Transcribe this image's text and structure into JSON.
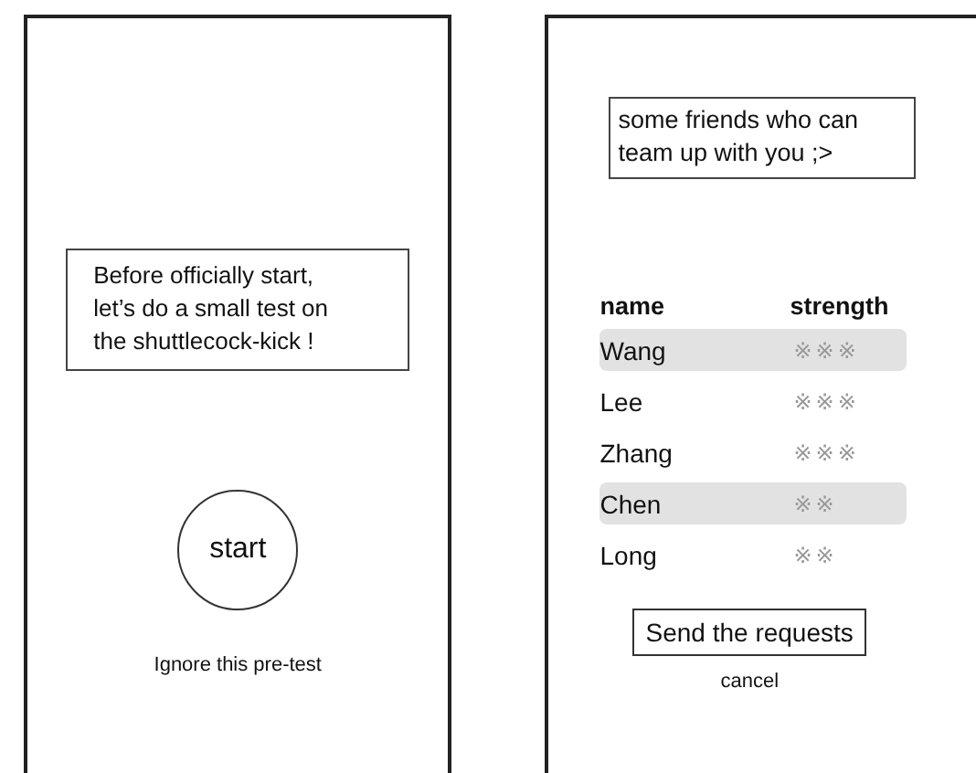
{
  "screens": [
    {
      "kind": "pretest",
      "message": "Before officially start, let’s do a small test on the shuttlecock-kick !",
      "start_button": "start",
      "skip_link": "Ignore this pre-test"
    },
    {
      "kind": "friends",
      "message": "some friends who can team up with you ;>",
      "columns": [
        "name",
        "strength"
      ],
      "rows": [
        {
          "name": "Wang",
          "strength": "※※※",
          "selected": true
        },
        {
          "name": "Lee",
          "strength": "※※※",
          "selected": false
        },
        {
          "name": "Zhang",
          "strength": "※※※",
          "selected": false
        },
        {
          "name": "Chen",
          "strength": "※※",
          "selected": true
        },
        {
          "name": "Long",
          "strength": "※※",
          "selected": false
        }
      ],
      "send_button": "Send the requests",
      "cancel_link": "cancel"
    }
  ]
}
